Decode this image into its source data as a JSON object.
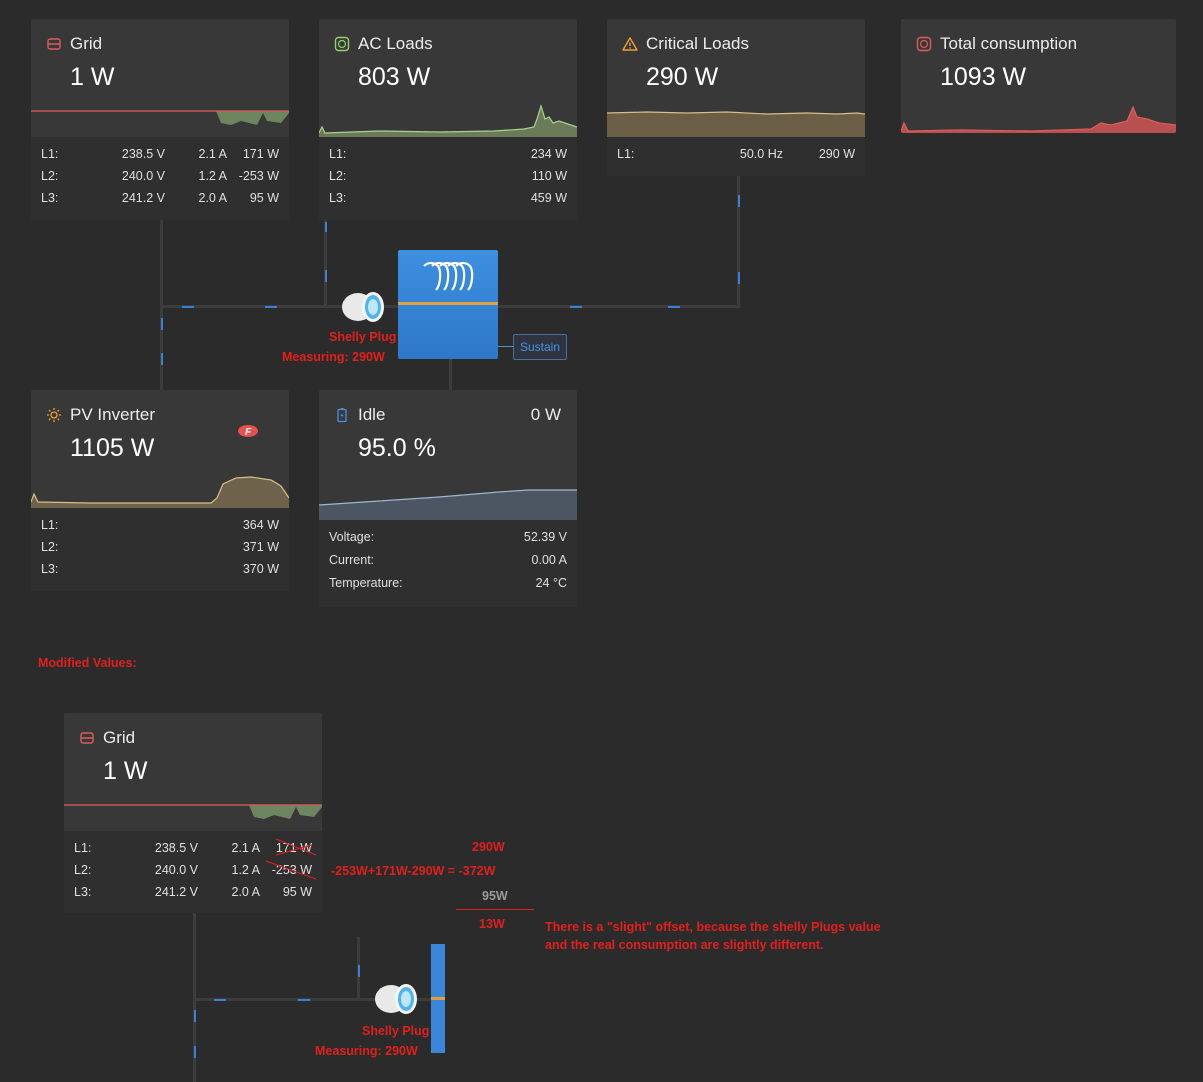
{
  "colors": {
    "grid_accent": "#e05b5b",
    "acloads_accent": "#8fd36a",
    "critical_accent": "#f0a030",
    "pv_accent": "#f0a030",
    "battery_accent": "#4a90e2",
    "annotation_red": "#e0201e"
  },
  "grid": {
    "title": "Grid",
    "value": "1 W",
    "rows": [
      {
        "label": "L1:",
        "voltage": "238.5 V",
        "current": "2.1 A",
        "power": "171 W"
      },
      {
        "label": "L2:",
        "voltage": "240.0 V",
        "current": "1.2 A",
        "power": "-253 W"
      },
      {
        "label": "L3:",
        "voltage": "241.2 V",
        "current": "2.0 A",
        "power": "95 W"
      }
    ]
  },
  "ac_loads": {
    "title": "AC Loads",
    "value": "803 W",
    "rows": [
      {
        "label": "L1:",
        "power": "234 W"
      },
      {
        "label": "L2:",
        "power": "110 W"
      },
      {
        "label": "L3:",
        "power": "459 W"
      }
    ]
  },
  "critical_loads": {
    "title": "Critical Loads",
    "value": "290 W",
    "rows": [
      {
        "label": "L1:",
        "frequency": "50.0 Hz",
        "power": "290 W"
      }
    ]
  },
  "total_consumption": {
    "title": "Total consumption",
    "value": "1093 W"
  },
  "inverter": {
    "sustain_label": "Sustain"
  },
  "shelly": {
    "line1": "Shelly Plug",
    "line2": "Measuring: 290W"
  },
  "pv_inverter": {
    "title": "PV Inverter",
    "value": "1105 W",
    "rows": [
      {
        "label": "L1:",
        "power": "364 W"
      },
      {
        "label": "L2:",
        "power": "371 W"
      },
      {
        "label": "L3:",
        "power": "370 W"
      }
    ]
  },
  "battery": {
    "title": "Idle",
    "power": "0 W",
    "value": "95.0 %",
    "rows": [
      {
        "label": "Voltage:",
        "value": "52.39 V"
      },
      {
        "label": "Current:",
        "value": "0.00 A"
      },
      {
        "label": "Temperature:",
        "value": "24 °C"
      }
    ]
  },
  "modified": {
    "heading": "Modified Values:",
    "grid": {
      "title": "Grid",
      "value": "1 W",
      "rows": [
        {
          "label": "L1:",
          "voltage": "238.5 V",
          "current": "2.1 A",
          "power": "171 W"
        },
        {
          "label": "L2:",
          "voltage": "240.0 V",
          "current": "1.2 A",
          "power": "-253 W"
        },
        {
          "label": "L3:",
          "voltage": "241.2 V",
          "current": "2.0 A",
          "power": "95 W"
        }
      ]
    },
    "calc_290": "290W",
    "calc_formula": "-253W+171W-290W = -372W",
    "calc_95": "95W",
    "calc_result": "13W",
    "note_line1": "There is a \"slight\" offset, because the shelly Plugs value",
    "note_line2": "and the real consumption are slightly different.",
    "shelly_line1": "Shelly Plug",
    "shelly_line2": "Measuring: 290W"
  }
}
